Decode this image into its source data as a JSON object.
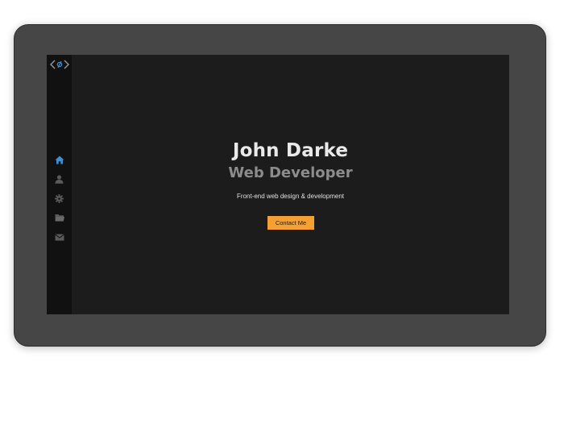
{
  "hero": {
    "name": "John Darke",
    "role": "Web Developer",
    "tagline": "Front-end web design & development",
    "cta_label": "Contact Me"
  },
  "sidebar": {
    "logo_icon": "code-logo-icon",
    "items": [
      {
        "icon": "home-icon",
        "active": true
      },
      {
        "icon": "user-icon",
        "active": false
      },
      {
        "icon": "gear-icon",
        "active": false
      },
      {
        "icon": "folder-icon",
        "active": false
      },
      {
        "icon": "envelope-icon",
        "active": false
      }
    ]
  },
  "colors": {
    "accent": "#f5a033",
    "active_icon": "#3a8fd6",
    "inactive_icon": "#5a5a5a",
    "screen_bg": "#1c1c1c",
    "sidebar_bg": "#111111",
    "device_frame": "#464646"
  }
}
